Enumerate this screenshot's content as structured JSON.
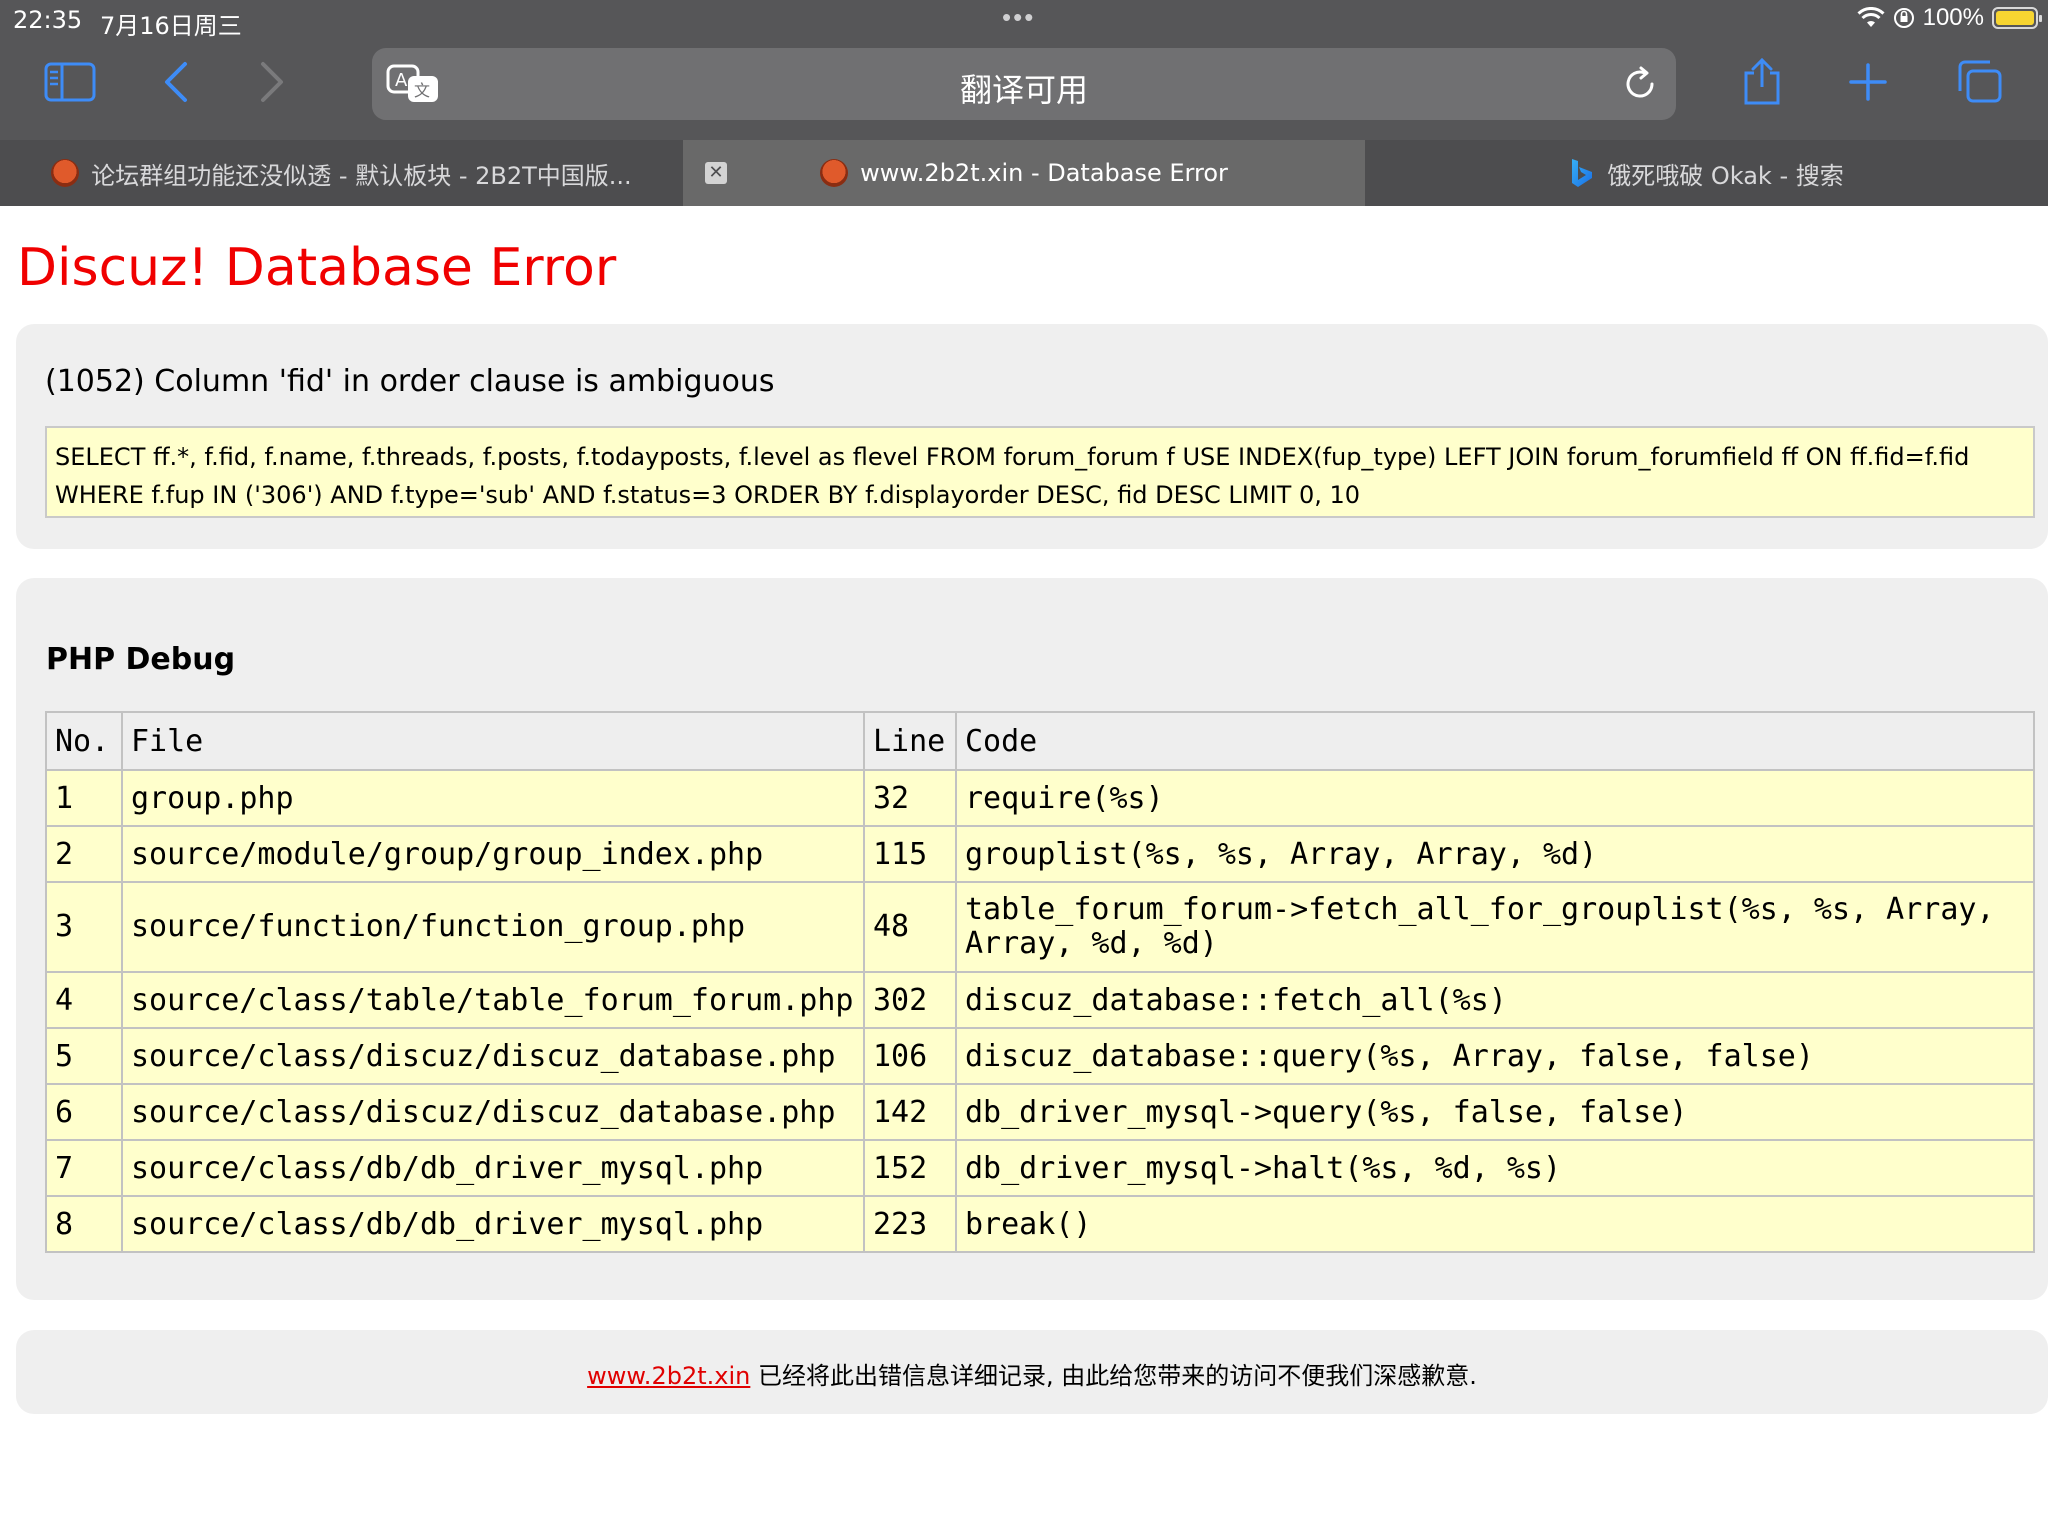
{
  "status_bar": {
    "time": "22:35",
    "date": "7月16日周三",
    "dots": "•••",
    "battery": "100%"
  },
  "toolbar": {
    "url_text": "翻译可用",
    "icons": [
      "sidebar-icon",
      "back-icon",
      "forward-icon",
      "translate-icon",
      "reload-icon",
      "share-icon",
      "new-tab-icon",
      "tabs-overview-icon"
    ],
    "accent": "#3e8cf7"
  },
  "tabs": [
    {
      "title": "论坛群组功能还没似透 - 默认板块 - 2B2T中国版..."
    },
    {
      "title": "www.2b2t.xin - Database Error",
      "close": "✕"
    },
    {
      "title": "饿死哦破 Okak - 搜索"
    }
  ],
  "error": {
    "heading": "Discuz! Database Error",
    "message": "(1052) Column 'fid' in order clause is ambiguous",
    "sql_line1": "SELECT ff.*, f.fid, f.name, f.threads, f.posts, f.todayposts, f.level as flevel FROM forum_forum f USE INDEX(fup_type) LEFT JOIN forum_forumfield ff ON ff.fid=f.fid",
    "sql_line2": "WHERE f.fup IN ('306') AND f.type='sub' AND f.status=3 ORDER BY f.displayorder DESC, fid DESC LIMIT 0, 10",
    "heading_color": "#f00000"
  },
  "debug": {
    "title": "PHP Debug",
    "headers": [
      "No.",
      "File",
      "Line",
      "Code"
    ],
    "rows": [
      {
        "no": "1",
        "file": "group.php",
        "line": "32",
        "code": "require(%s)"
      },
      {
        "no": "2",
        "file": "source/module/group/group_index.php",
        "line": "115",
        "code": "grouplist(%s, %s, Array, Array, %d)"
      },
      {
        "no": "3",
        "file": "source/function/function_group.php",
        "line": "48",
        "code": "table_forum_forum->fetch_all_for_grouplist(%s, %s, Array, Array, %d, %d)"
      },
      {
        "no": "4",
        "file": "source/class/table/table_forum_forum.php",
        "line": "302",
        "code": "discuz_database::fetch_all(%s)"
      },
      {
        "no": "5",
        "file": "source/class/discuz/discuz_database.php",
        "line": "106",
        "code": "discuz_database::query(%s, Array, false, false)"
      },
      {
        "no": "6",
        "file": "source/class/discuz/discuz_database.php",
        "line": "142",
        "code": "db_driver_mysql->query(%s, false, false)"
      },
      {
        "no": "7",
        "file": "source/class/db/db_driver_mysql.php",
        "line": "152",
        "code": "db_driver_mysql->halt(%s, %d, %s)"
      },
      {
        "no": "8",
        "file": "source/class/db/db_driver_mysql.php",
        "line": "223",
        "code": "break()"
      }
    ]
  },
  "footer": {
    "link": "www.2b2t.xin",
    "text": " 已经将此出错信息详细记录, 由此给您带来的访问不便我们深感歉意."
  }
}
